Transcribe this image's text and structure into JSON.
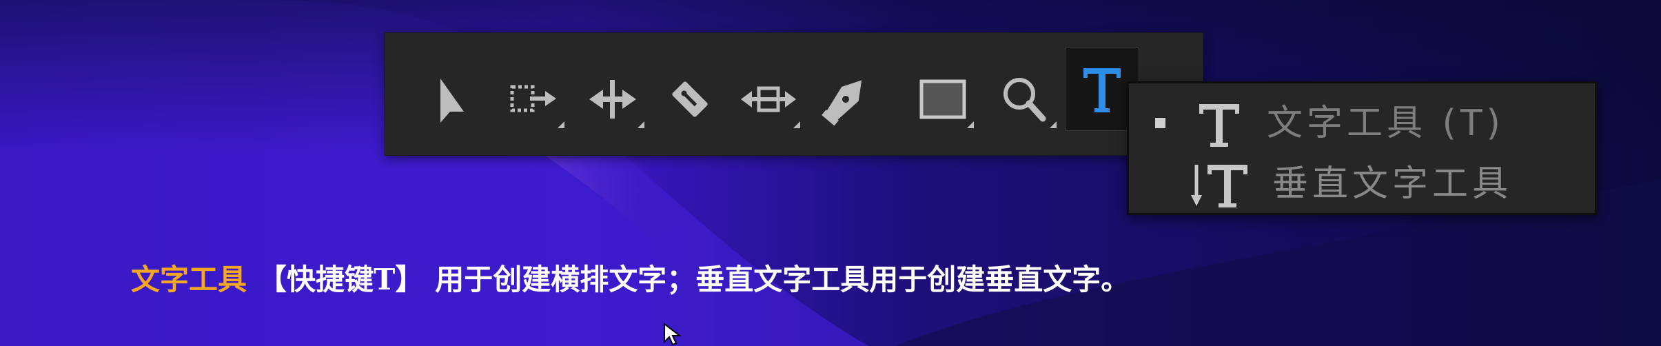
{
  "toolbar": {
    "tools": [
      {
        "icon": "selection-arrow-icon",
        "has_submenu": false
      },
      {
        "icon": "track-select-icon",
        "has_submenu": true
      },
      {
        "icon": "ripple-edit-icon",
        "has_submenu": true
      },
      {
        "icon": "razor-icon",
        "has_submenu": false
      },
      {
        "icon": "slip-icon",
        "has_submenu": true
      },
      {
        "icon": "pen-icon",
        "has_submenu": false
      },
      {
        "icon": "rectangle-icon",
        "has_submenu": true
      },
      {
        "icon": "zoom-icon",
        "has_submenu": true
      },
      {
        "icon": "type-tool-icon",
        "active": true
      }
    ],
    "active_color": "#2f8ee8"
  },
  "popup_menu": {
    "items": [
      {
        "icon": "type-tool-icon",
        "label": "文字工具 (T)",
        "selected": true
      },
      {
        "icon": "vertical-type-tool-icon",
        "label": "垂直文字工具",
        "selected": false
      }
    ]
  },
  "caption": {
    "highlight": "文字工具",
    "shortcut": "【快捷键T】",
    "body": "用于创建横排文字；垂直文字工具用于创建垂直文字。",
    "highlight_color": "#f5a623"
  }
}
